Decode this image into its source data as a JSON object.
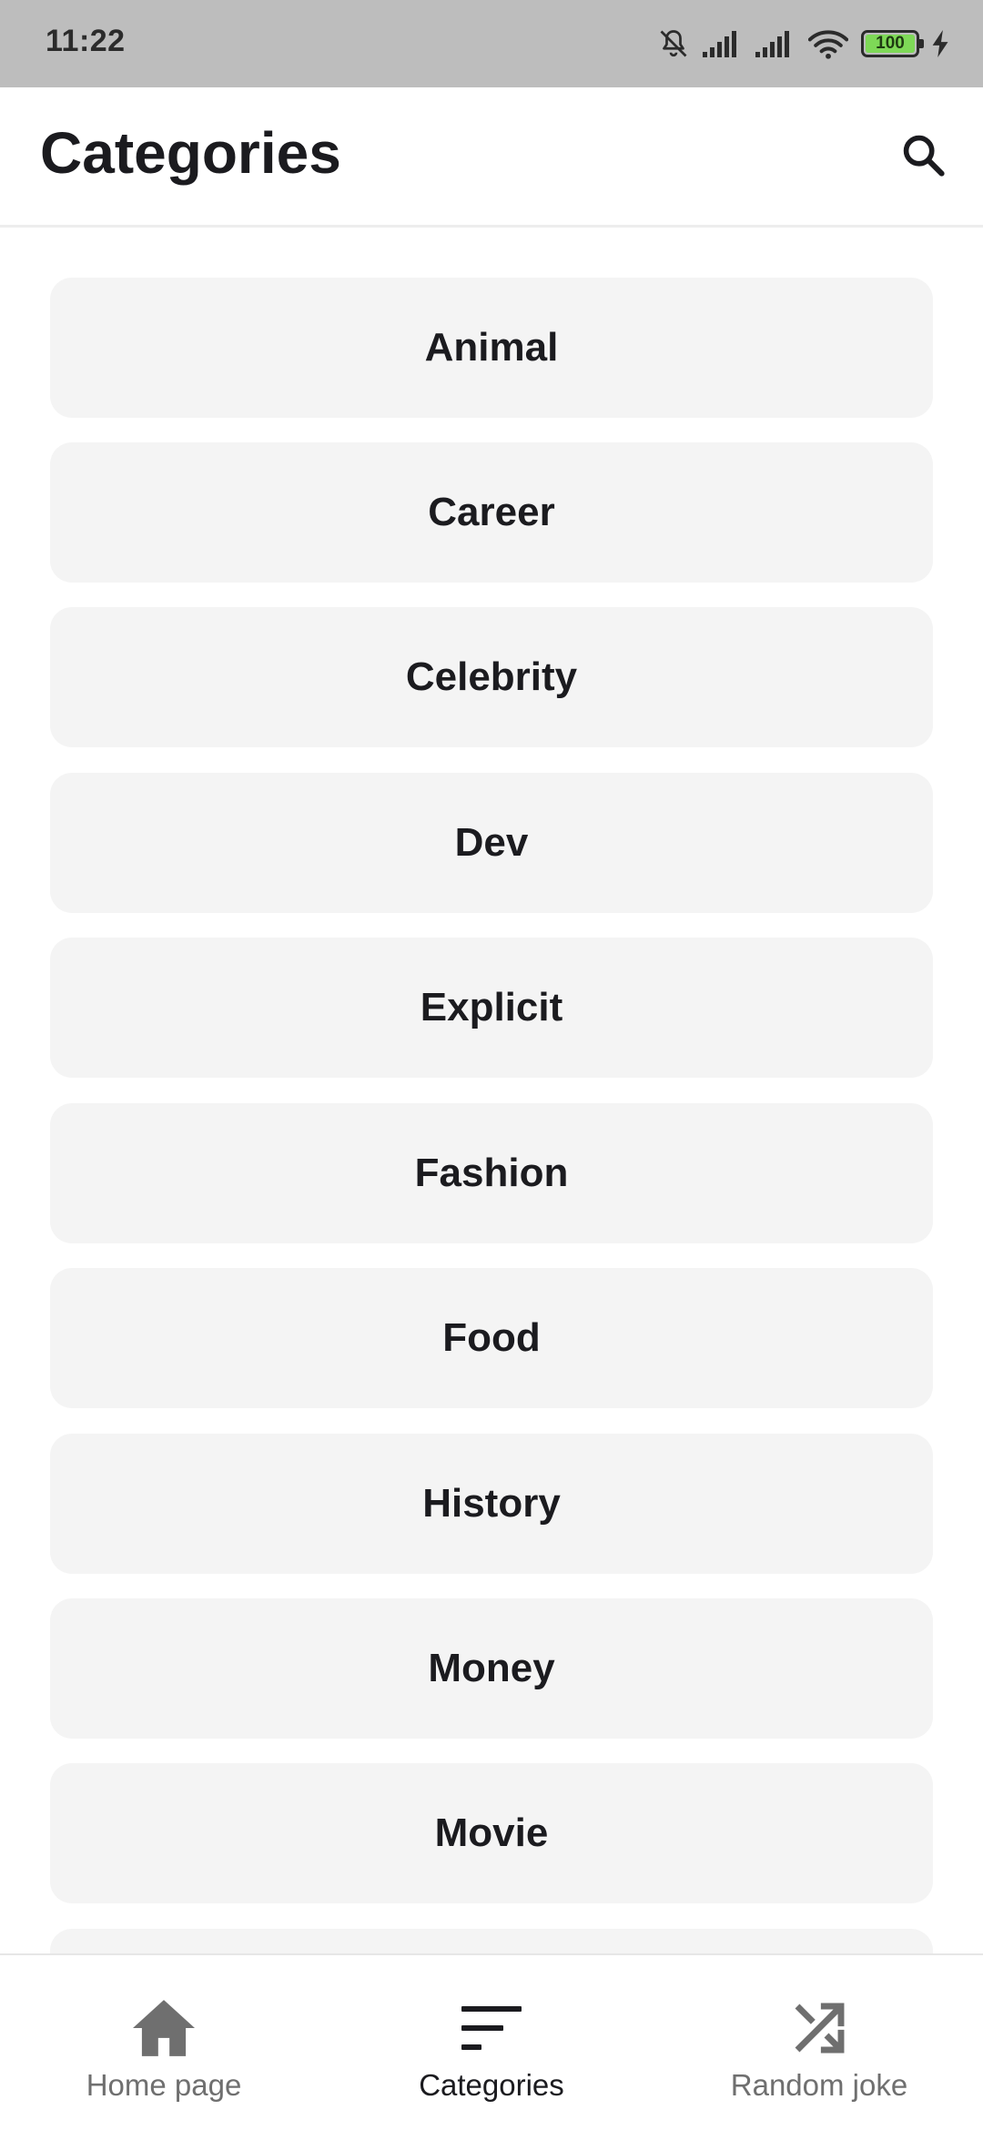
{
  "status_bar": {
    "time": "11:22",
    "battery_level": "100",
    "icons": [
      "bell-off-icon",
      "signal-icon",
      "signal-icon",
      "wifi-icon",
      "battery-icon",
      "charging-bolt-icon"
    ]
  },
  "app_bar": {
    "title": "Categories",
    "search_icon": "search-icon"
  },
  "categories": [
    {
      "label": "Animal"
    },
    {
      "label": "Career"
    },
    {
      "label": "Celebrity"
    },
    {
      "label": "Dev"
    },
    {
      "label": "Explicit"
    },
    {
      "label": "Fashion"
    },
    {
      "label": "Food"
    },
    {
      "label": "History"
    },
    {
      "label": "Money"
    },
    {
      "label": "Movie"
    },
    {
      "label": ""
    }
  ],
  "bottom_nav": {
    "items": [
      {
        "label": "Home page",
        "icon": "home-icon",
        "active": false
      },
      {
        "label": "Categories",
        "icon": "sort-icon",
        "active": true
      },
      {
        "label": "Random joke",
        "icon": "shuffle-icon",
        "active": false
      }
    ]
  },
  "colors": {
    "status_bar_bg": "#bdbdbd",
    "card_bg": "#f4f4f4",
    "text_primary": "#1b1b1f",
    "nav_inactive": "#6f6f6f",
    "battery_fill": "#7ed957"
  }
}
